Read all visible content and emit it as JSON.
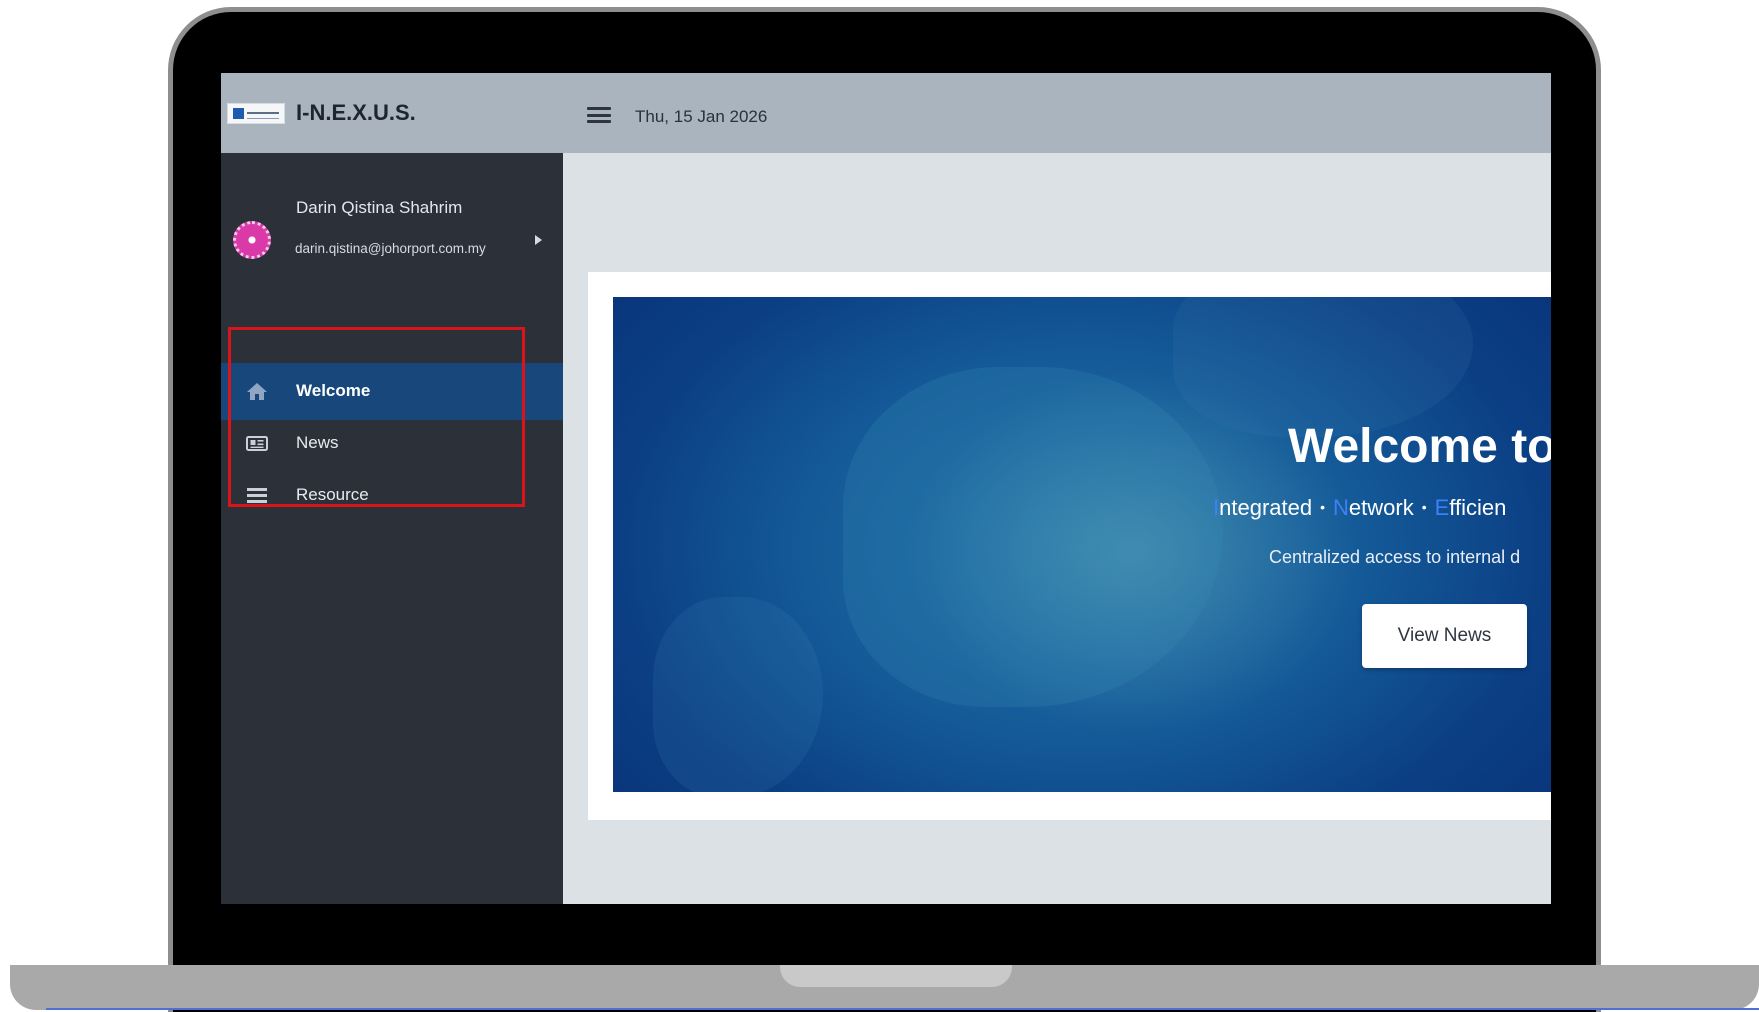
{
  "header": {
    "app_title": "I-N.E.X.U.S.",
    "date": "Thu, 15 Jan 2026",
    "menu_icon": "hamburger-menu-icon"
  },
  "user": {
    "name": "Darin Qistina Shahrim",
    "email": "darin.qistina@johorport.com.my"
  },
  "sidebar": {
    "items": [
      {
        "label": "Welcome",
        "icon": "home-icon",
        "active": true
      },
      {
        "label": "News",
        "icon": "newspaper-icon",
        "active": false
      },
      {
        "label": "Resource",
        "icon": "list-icon",
        "active": false
      }
    ],
    "highlight_color": "#d9141b"
  },
  "hero": {
    "title": "Welcome to",
    "tagline": {
      "word1_initial": "I",
      "word1_rest": "ntegrated",
      "word2_initial": "N",
      "word2_rest": "etwork",
      "word3_initial": "E",
      "word3_rest": "fficien",
      "separator": "•"
    },
    "description": "Centralized access to internal d",
    "button_label": "View News"
  },
  "colors": {
    "topbar": "#a9b4bf",
    "sidebar": "#2b3039",
    "active_item": "#17477b",
    "accent_letter": "#3b82f6"
  }
}
